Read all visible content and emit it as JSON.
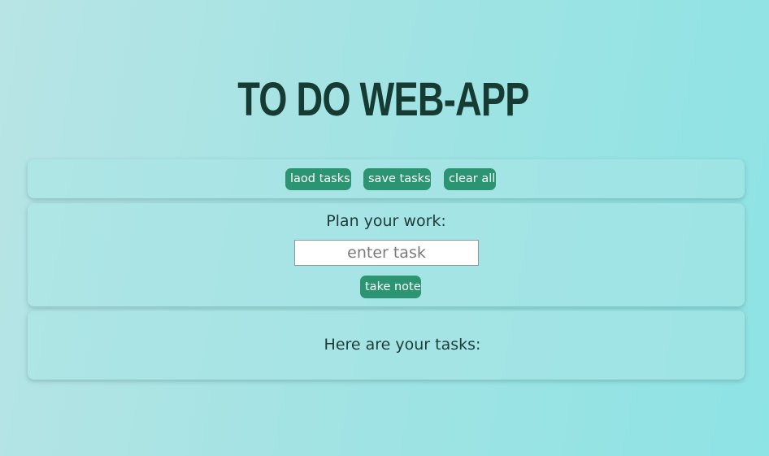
{
  "header": {
    "title": "TO DO WEB-APP"
  },
  "toolbar": {
    "load_label": "laod tasks",
    "save_label": "save tasks",
    "clear_label": "clear all"
  },
  "input_panel": {
    "prompt": "Plan your work:",
    "input_placeholder": "enter task",
    "input_value": "",
    "submit_label": "take note"
  },
  "tasks_panel": {
    "heading": "Here are your tasks:",
    "items": []
  },
  "colors": {
    "button_bg": "#2b9470",
    "title_text": "#153b33",
    "body_text": "#1d3b38"
  }
}
